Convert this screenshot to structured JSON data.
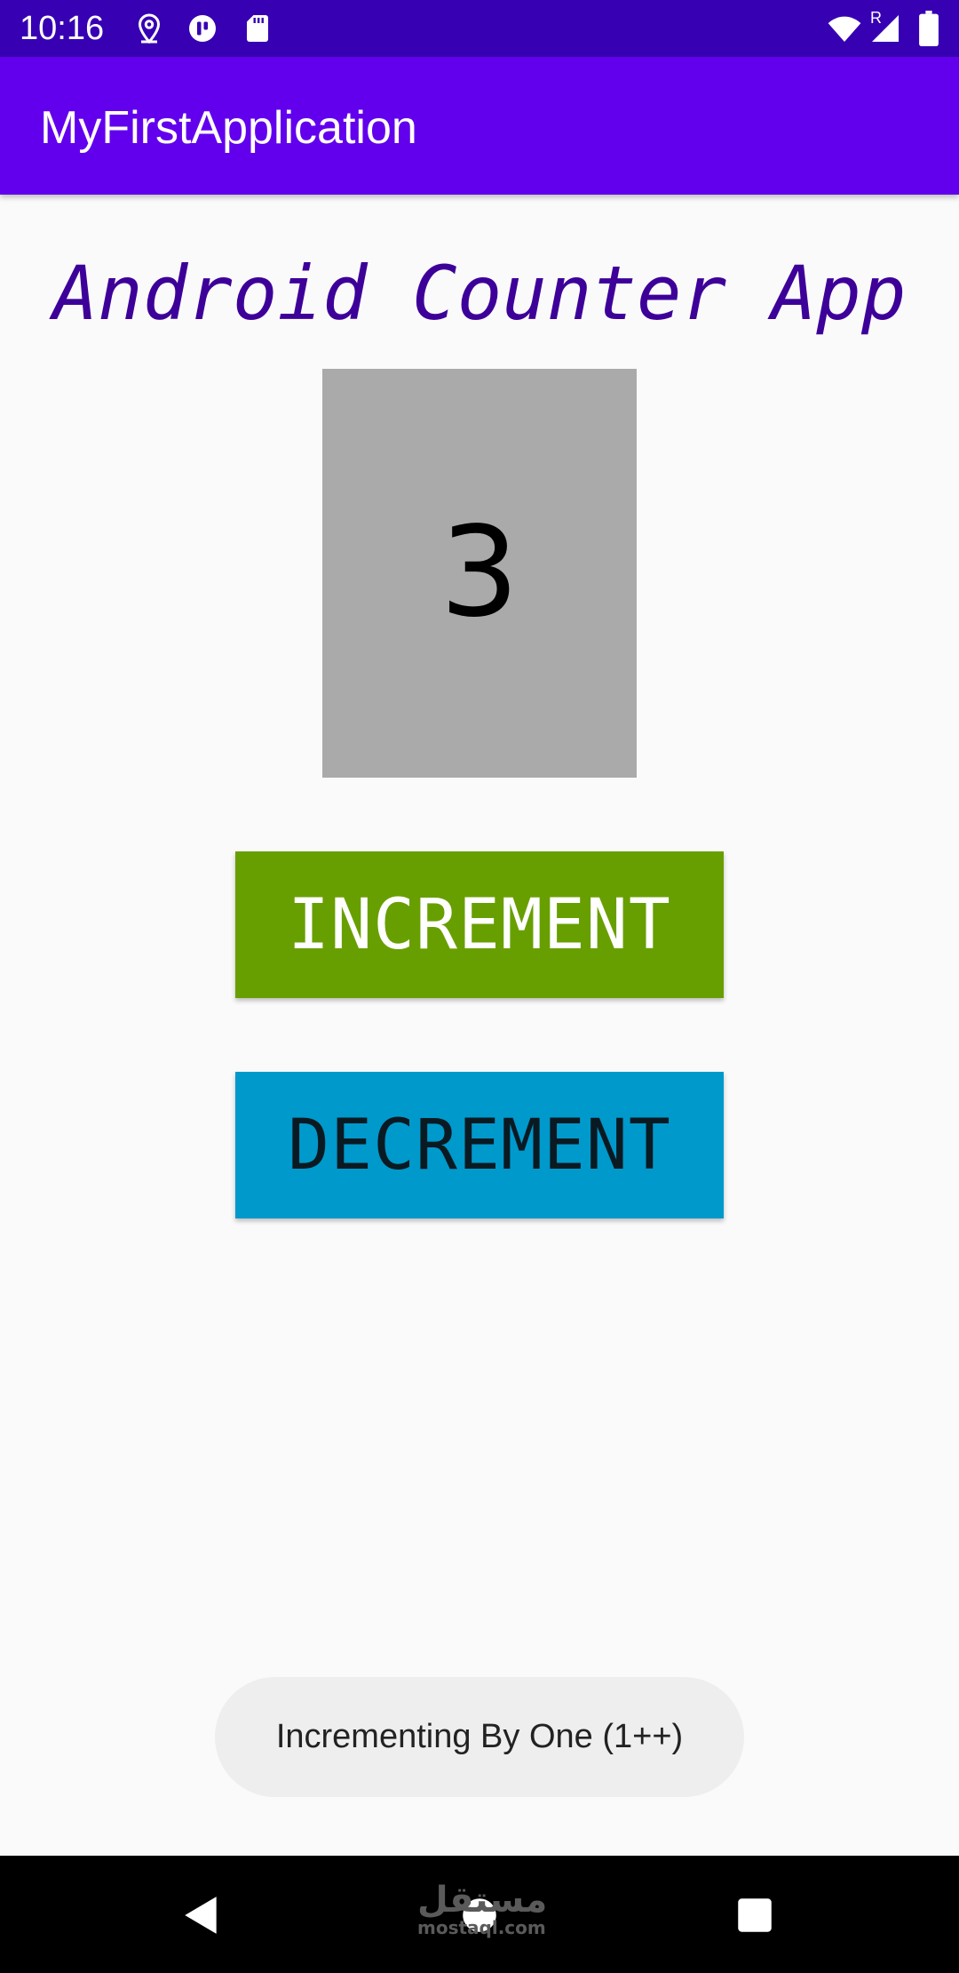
{
  "status_bar": {
    "time": "10:16",
    "icons_left": [
      "location-icon",
      "app-notification-icon",
      "sd-card-icon"
    ],
    "icons_right": [
      "wifi-icon",
      "signal-roaming-icon",
      "battery-icon"
    ],
    "roaming_indicator": "R"
  },
  "app_bar": {
    "title": "MyFirstApplication"
  },
  "main": {
    "heading": "Android Counter App",
    "counter_value": "3",
    "increment_label": "INCREMENT",
    "decrement_label": "DECREMENT"
  },
  "toast": {
    "message": "Incrementing By One (1++)"
  },
  "nav_bar": {
    "buttons": [
      "back-icon",
      "home-icon",
      "recents-icon"
    ]
  },
  "watermark": {
    "arabic": "مستقل",
    "latin": "mostaql.com"
  },
  "colors": {
    "status_bar": "#3700b3",
    "app_bar": "#6200ee",
    "heading": "#3d0099",
    "counter_box": "#aaaaaa",
    "increment_button": "#689f00",
    "decrement_button": "#0099cc",
    "toast_bg": "#eeeeee",
    "nav_bar": "#000000",
    "background": "#fafafa"
  }
}
